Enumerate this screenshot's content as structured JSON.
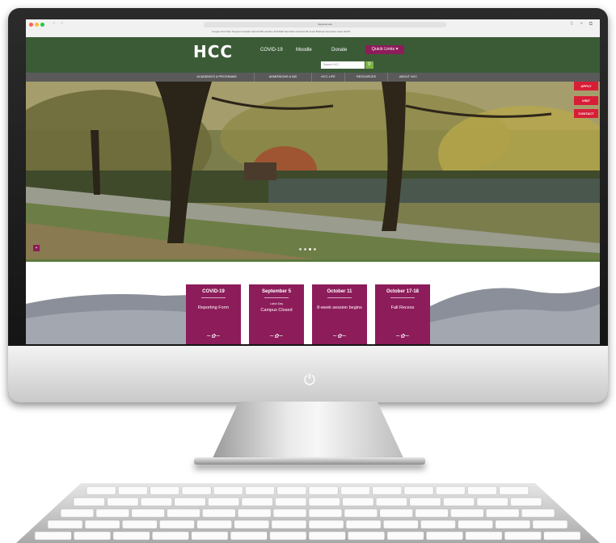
{
  "browser": {
    "url": "haywood.edu",
    "bookmarks": "Google   HCC   Pam Frequenti Update   Schmid   Bb Lactrace   TechPath   New Web   Contents   Bl Count   Barbara   Openware   Laser SHST",
    "nav_icons": "‹ ›",
    "right_icons": "⇧ + ⧉"
  },
  "site": {
    "logo": "HCC",
    "top_links": [
      "COVID-19",
      "Moodle",
      "Donate"
    ],
    "quick_links": "Quick Links ▾",
    "search_placeholder": "Search HCC",
    "search_button": "⚲",
    "nav": [
      "ACADEMICS & PROGRAMS",
      "ADMISSIONS & AID",
      "HCC LIFE",
      "RESOURCES",
      "ABOUT HCC"
    ],
    "side_buttons": [
      "APPLY",
      "VISIT",
      "CONTACT"
    ],
    "hero_control": "▪"
  },
  "cards": [
    {
      "title": "COVID-19",
      "small": "",
      "sub": "Reporting Form"
    },
    {
      "title": "September 5",
      "small": "Labor Day",
      "sub": "Campus Closed"
    },
    {
      "title": "October 11",
      "small": "",
      "sub": "8-week session begins"
    },
    {
      "title": "October 17-18",
      "small": "",
      "sub": "Fall Recess"
    }
  ],
  "monitor": {
    "power_icon": "⏻"
  },
  "colors": {
    "header_green": "#3b5b37",
    "accent_magenta": "#8d1c5a",
    "red": "#d81e37"
  }
}
